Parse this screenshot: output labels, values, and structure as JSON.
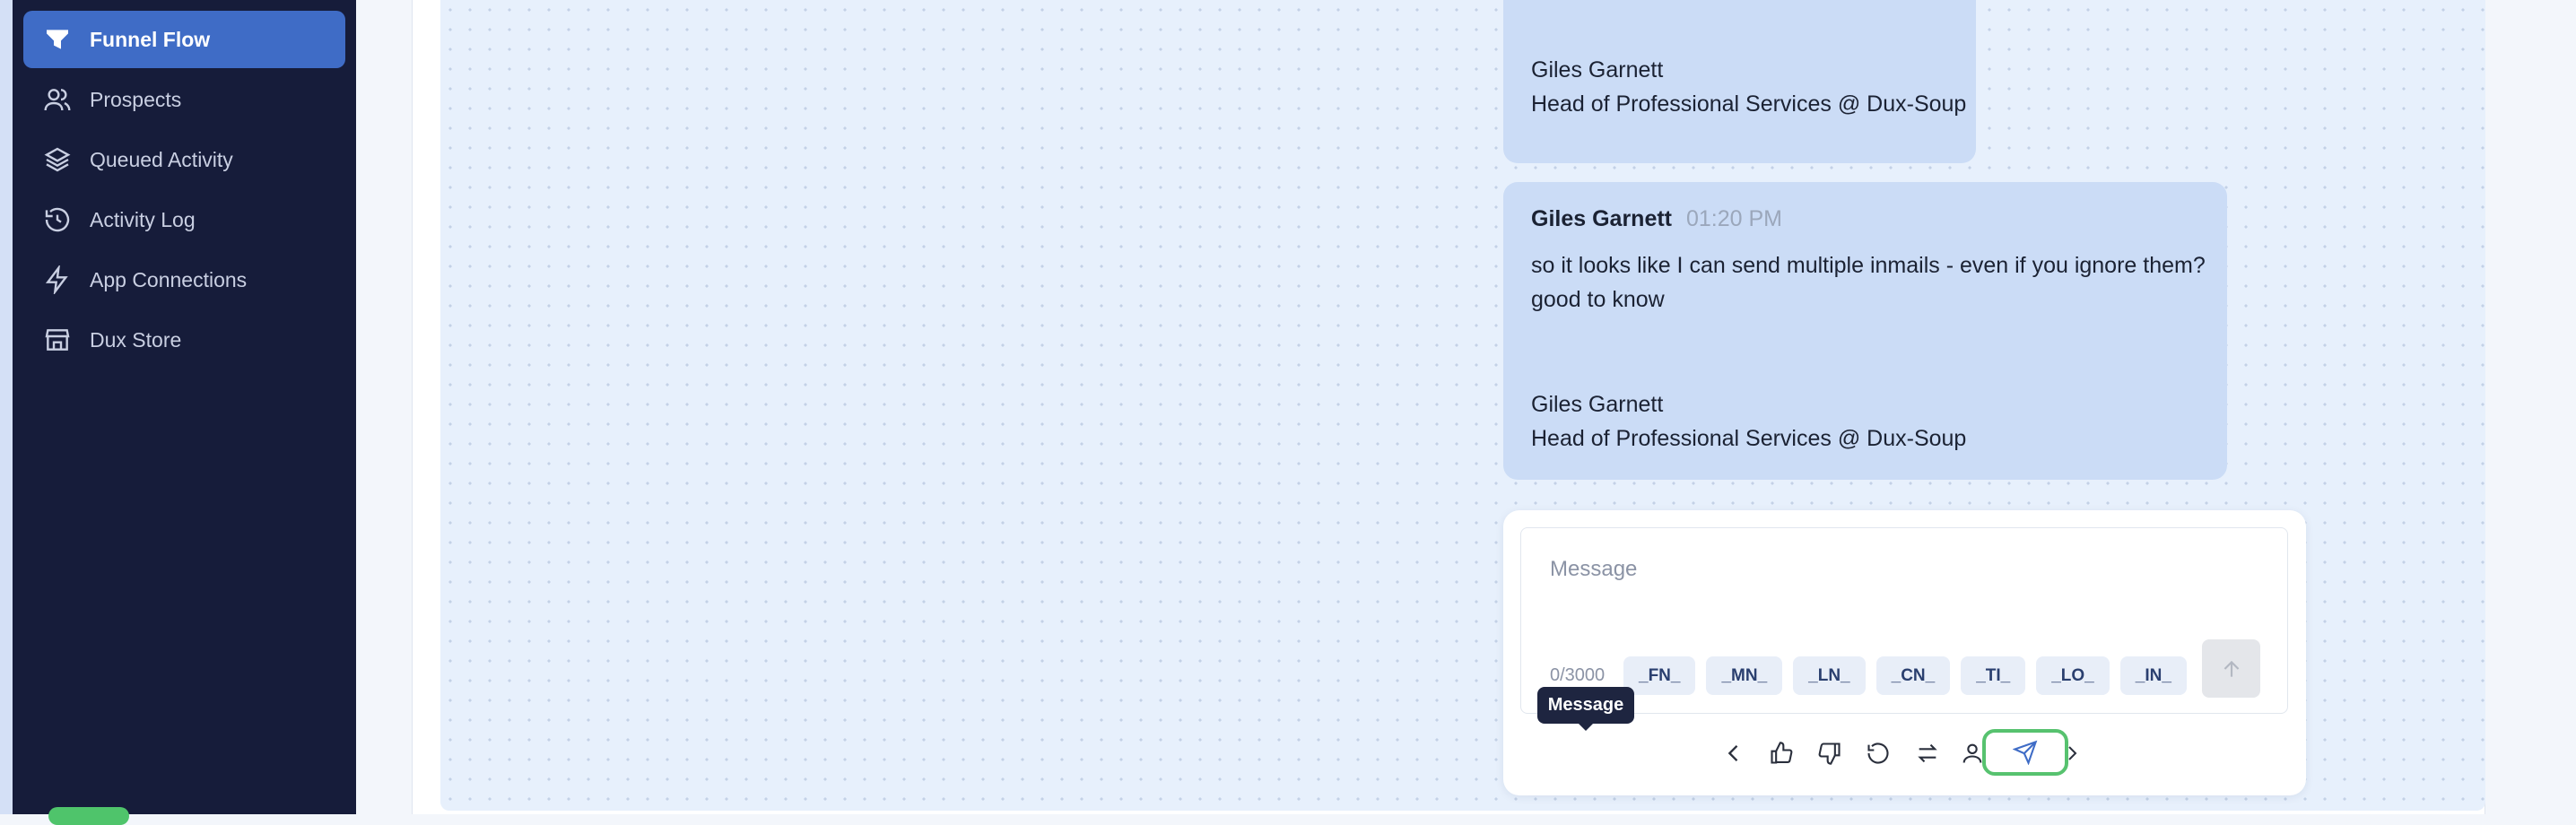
{
  "sidebar": {
    "items": [
      {
        "label": "Funnel Flow",
        "icon": "funnel-icon",
        "active": true
      },
      {
        "label": "Prospects",
        "icon": "users-icon",
        "active": false
      },
      {
        "label": "Queued Activity",
        "icon": "layers-icon",
        "active": false
      },
      {
        "label": "Activity Log",
        "icon": "history-icon",
        "active": false
      },
      {
        "label": "App Connections",
        "icon": "lightning-icon",
        "active": false
      },
      {
        "label": "Dux Store",
        "icon": "store-icon",
        "active": false
      }
    ]
  },
  "messages": [
    {
      "signature_name": "Giles Garnett",
      "signature_title": "Head of Professional Services @ Dux-Soup"
    },
    {
      "sender": "Giles Garnett",
      "time": "01:20 PM",
      "text_line1": "so it looks like I can send multiple inmails - even if you ignore them?",
      "text_line2": "good to know",
      "signature_name": "Giles Garnett",
      "signature_title": "Head of Professional Services @ Dux-Soup"
    }
  ],
  "composer": {
    "placeholder": "Message",
    "counter": "0/3000",
    "tokens": [
      "_FN_",
      "_MN_",
      "_LN_",
      "_CN_",
      "_TI_",
      "_LO_",
      "_IN_"
    ],
    "tooltip": "Message"
  },
  "colors": {
    "sidebar_bg": "#161c3a",
    "active_item": "#3f6cc6",
    "bubble": "#cbdcf6",
    "highlight": "#57c26f"
  }
}
